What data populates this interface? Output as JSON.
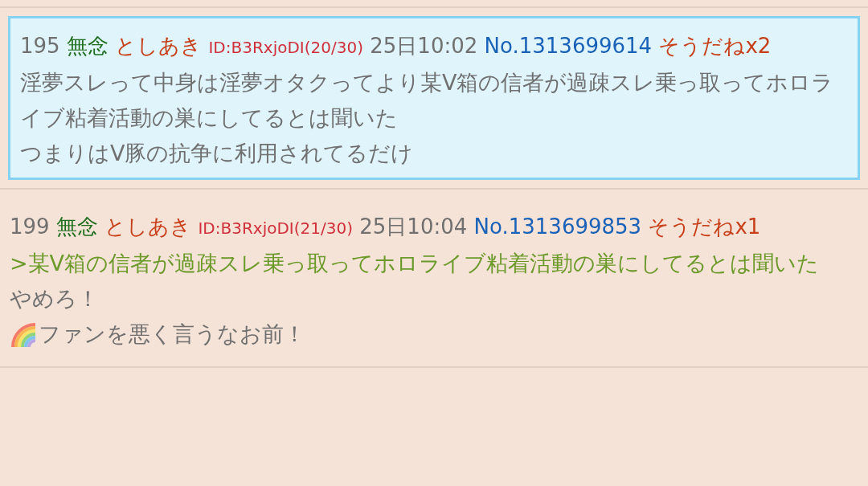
{
  "posts": [
    {
      "number": "195",
      "subject": "無念",
      "name": "としあき",
      "id": "ID:B3RxjoDI(20/30)",
      "date": "25日10:02",
      "no": "No.1313699614",
      "sodane": "そうだねx2",
      "highlighted": true,
      "lines": [
        {
          "kind": "plain",
          "text": "淫夢スレって中身は淫夢オタクってより某V箱の信者が過疎スレ乗っ取ってホロライブ粘着活動の巣にしてるとは聞いた"
        },
        {
          "kind": "plain",
          "text": "つまりはV豚の抗争に利用されてるだけ"
        }
      ]
    },
    {
      "number": "199",
      "subject": "無念",
      "name": "としあき",
      "id": "ID:B3RxjoDI(21/30)",
      "date": "25日10:04",
      "no": "No.1313699853",
      "sodane": "そうだねx1",
      "highlighted": false,
      "lines": [
        {
          "kind": "quote",
          "text": ">某V箱の信者が過疎スレ乗っ取ってホロライブ粘着活動の巣にしてるとは聞いた"
        },
        {
          "kind": "plain",
          "text": "やめろ！"
        },
        {
          "kind": "with_icon",
          "text": "ファンを悪く言うなお前！"
        }
      ]
    }
  ]
}
